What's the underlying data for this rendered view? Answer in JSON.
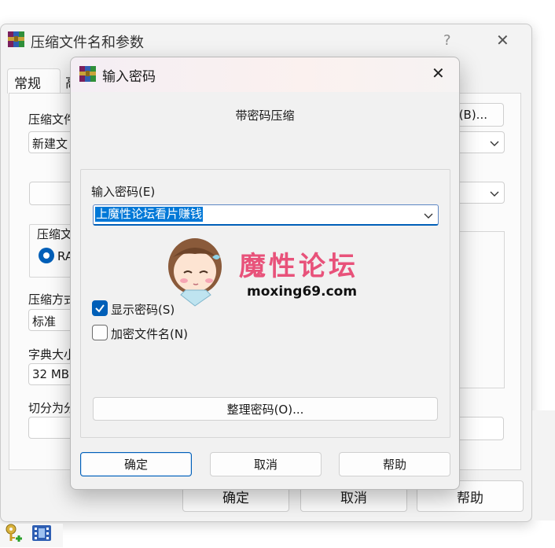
{
  "background_window": {
    "title": "压缩文件名和参数",
    "help": "?",
    "close_glyph": "✕",
    "tabs": [
      "常规",
      "高"
    ],
    "labels": {
      "archive_name": "压缩文件",
      "archive_format": "压缩文",
      "compression_method": "压缩方式",
      "dictionary_size": "字典大小",
      "split": "切分为分"
    },
    "values": {
      "archive_name": "新建文",
      "format_radio": "RA",
      "compression_method": "标准",
      "dictionary_size": "32 MB"
    },
    "browse_button": "(B)...",
    "buttons": {
      "ok": "确定",
      "cancel": "取消",
      "help": "帮助"
    }
  },
  "dialog": {
    "title": "输入密码",
    "close_glyph": "✕",
    "header": "带密码压缩",
    "password_label": "输入密码(E)",
    "password_value": "上魔性论坛看片赚钱",
    "show_password": {
      "label": "显示密码(S)",
      "checked": true
    },
    "encrypt_names": {
      "label": "加密文件名(N)",
      "checked": false
    },
    "organize_button": "整理密码(O)...",
    "buttons": {
      "ok": "确定",
      "cancel": "取消",
      "help": "帮助"
    }
  },
  "watermark": {
    "brand": "魔性论坛",
    "url": "moxing69.com"
  },
  "colors": {
    "accent": "#005fb8",
    "selection": "#0078d7",
    "brand_pink": "#e8527a"
  }
}
